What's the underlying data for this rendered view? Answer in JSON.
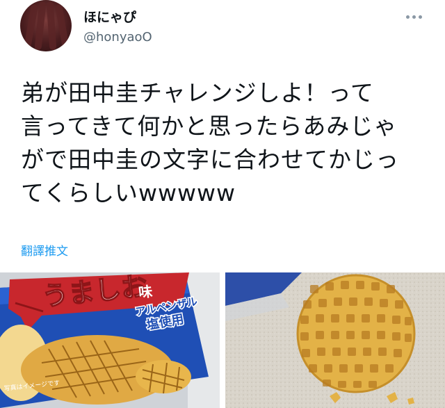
{
  "author": {
    "display_name": "ほにゃぴ",
    "handle": "@honyaoO"
  },
  "tweet": {
    "lines": [
      "弟が田中圭チャレンジしよ！って",
      "言ってきて何かと思ったらあみじゃ",
      "がで田中圭の文字に合わせてかじっ",
      "てくらしいwwwww"
    ],
    "translate_label": "翻譯推文"
  },
  "media": {
    "left": {
      "brand_text": "うましお",
      "flavor_suffix": "味",
      "sub_text": "アルペンザル",
      "salt_label": "塩使用",
      "note_text": "写真はイメージです"
    }
  },
  "colors": {
    "link": "#1d9bf0",
    "handle": "#536471",
    "bag_blue": "#1f4fb5",
    "bag_red": "#c8272d",
    "chip_yellow": "#e8b64c"
  },
  "icons": {
    "more": "more-horizontal-icon"
  }
}
